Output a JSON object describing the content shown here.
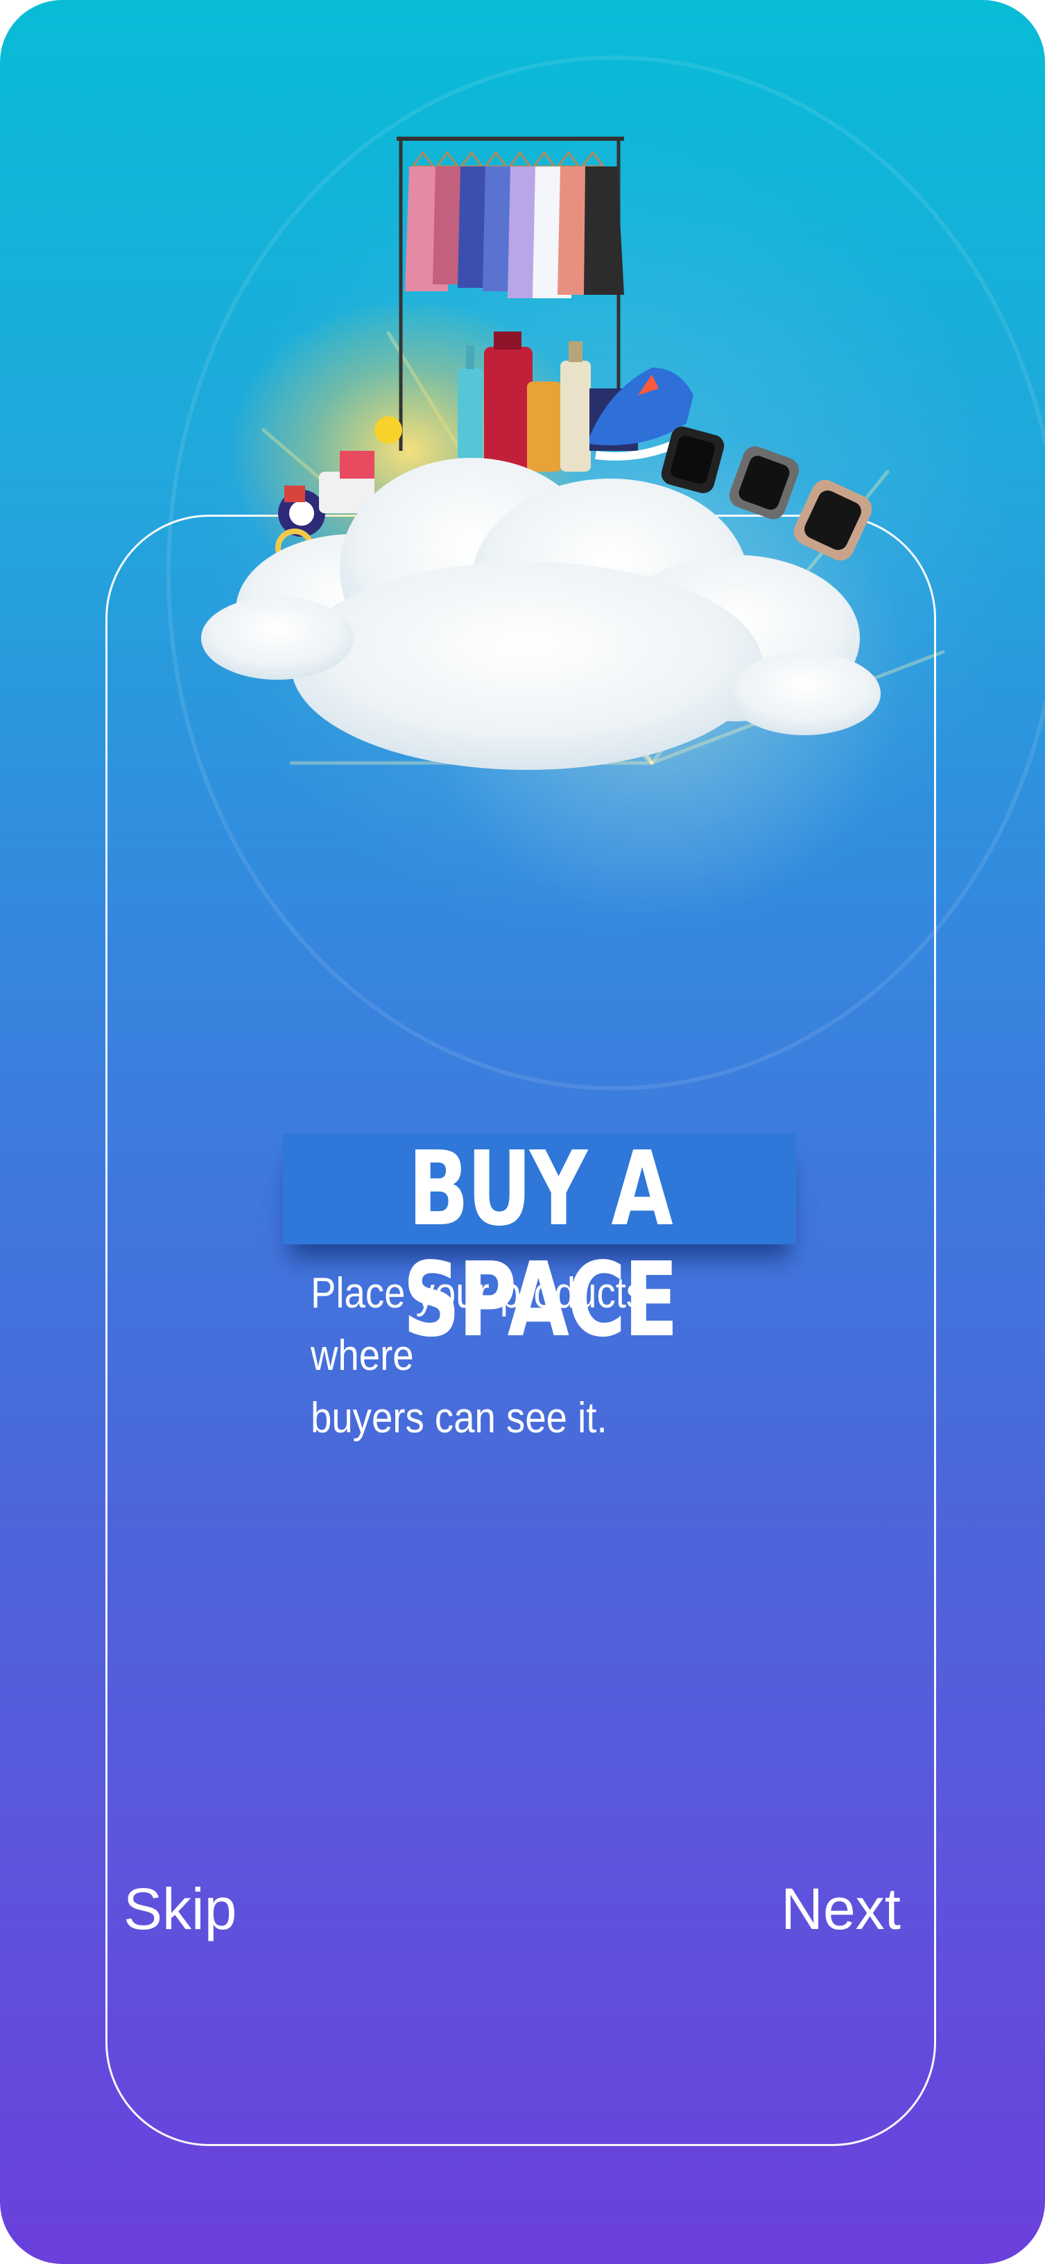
{
  "onboarding": {
    "title": "BUY A SPACE",
    "subtitle_line1": "Place your products where",
    "subtitle_line2": "buyers can see it.",
    "skip_label": "Skip",
    "next_label": "Next"
  },
  "colors": {
    "gradient_top": "#08bcd6",
    "gradient_bottom": "#6b3fdc",
    "title_background": "#2f77d8",
    "text": "#ffffff"
  },
  "illustration": {
    "icon": "cloud-marketplace-illustration"
  }
}
